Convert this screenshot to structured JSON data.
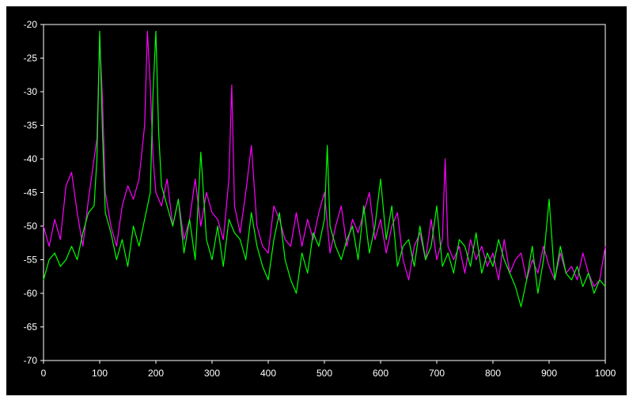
{
  "chart_data": {
    "type": "line",
    "title": "",
    "xlabel": "",
    "ylabel": "",
    "xlim": [
      0,
      1000
    ],
    "ylim": [
      -70,
      -20
    ],
    "x_ticks": [
      0,
      100,
      200,
      300,
      400,
      500,
      600,
      700,
      800,
      900,
      1000
    ],
    "y_ticks": [
      -20,
      -25,
      -30,
      -35,
      -40,
      -45,
      -50,
      -55,
      -60,
      -65,
      -70
    ],
    "x_tick_labels": [
      "0",
      "100",
      "200",
      "300",
      "400",
      "500",
      "600",
      "700",
      "800",
      "900",
      "1000"
    ],
    "y_tick_labels": [
      "-20",
      "-25",
      "-30",
      "-35",
      "-40",
      "-45",
      "-50",
      "-55",
      "-60",
      "-65",
      "-70"
    ],
    "grid": false,
    "legend": "none",
    "background_color": "#000000",
    "plot_area_border_color": "#ffffff",
    "tick_label_color": "#ffffff",
    "series": [
      {
        "color": "#ff00ff",
        "x": [
          0,
          10,
          20,
          30,
          40,
          50,
          60,
          70,
          80,
          90,
          95,
          100,
          105,
          110,
          120,
          130,
          140,
          150,
          160,
          170,
          180,
          185,
          190,
          195,
          200,
          210,
          220,
          230,
          240,
          250,
          260,
          270,
          280,
          290,
          300,
          310,
          320,
          330,
          335,
          340,
          350,
          360,
          370,
          380,
          390,
          400,
          410,
          420,
          430,
          440,
          450,
          460,
          470,
          480,
          490,
          500,
          510,
          520,
          530,
          540,
          550,
          560,
          570,
          580,
          590,
          600,
          610,
          620,
          630,
          640,
          650,
          660,
          670,
          680,
          690,
          700,
          710,
          715,
          720,
          730,
          740,
          750,
          760,
          770,
          780,
          790,
          800,
          810,
          820,
          830,
          840,
          850,
          860,
          870,
          880,
          890,
          900,
          910,
          920,
          930,
          940,
          950,
          960,
          970,
          980,
          990,
          1000
        ],
        "y": [
          -50,
          -53,
          -49,
          -52,
          -44,
          -42,
          -48,
          -53,
          -46,
          -40,
          -37,
          -22,
          -31,
          -45,
          -50,
          -53,
          -47,
          -44,
          -46,
          -43,
          -35,
          -21,
          -29,
          -40,
          -45,
          -47,
          -43,
          -50,
          -46,
          -52,
          -49,
          -43,
          -50,
          -45,
          -48,
          -49,
          -52,
          -43,
          -29,
          -47,
          -51,
          -45,
          -38,
          -50,
          -53,
          -54,
          -47,
          -49,
          -52,
          -53,
          -48,
          -53,
          -49,
          -52,
          -48,
          -45,
          -54,
          -50,
          -47,
          -53,
          -49,
          -51,
          -48,
          -45,
          -52,
          -49,
          -54,
          -50,
          -48,
          -55,
          -58,
          -53,
          -51,
          -55,
          -49,
          -55,
          -52,
          -40,
          -53,
          -55,
          -53,
          -57,
          -52,
          -55,
          -53,
          -56,
          -54,
          -58,
          -52,
          -57,
          -55,
          -54,
          -58,
          -55,
          -57,
          -53,
          -56,
          -58,
          -54,
          -57,
          -56,
          -58,
          -54,
          -57,
          -59,
          -58,
          -53
        ]
      },
      {
        "color": "#00ff00",
        "x": [
          0,
          10,
          20,
          30,
          40,
          50,
          60,
          70,
          80,
          90,
          95,
          100,
          105,
          110,
          120,
          130,
          140,
          150,
          160,
          170,
          180,
          190,
          195,
          200,
          205,
          210,
          220,
          230,
          240,
          250,
          260,
          270,
          280,
          290,
          300,
          310,
          320,
          330,
          340,
          350,
          360,
          370,
          380,
          390,
          400,
          410,
          420,
          430,
          440,
          450,
          460,
          470,
          480,
          490,
          500,
          505,
          510,
          520,
          530,
          540,
          550,
          560,
          570,
          580,
          590,
          600,
          610,
          620,
          630,
          640,
          650,
          660,
          670,
          680,
          690,
          700,
          710,
          720,
          730,
          740,
          750,
          760,
          770,
          780,
          790,
          800,
          810,
          820,
          830,
          840,
          850,
          860,
          870,
          880,
          890,
          900,
          910,
          920,
          930,
          940,
          950,
          960,
          970,
          980,
          990,
          1000
        ],
        "y": [
          -58,
          -55,
          -54,
          -56,
          -55,
          -53,
          -55,
          -51,
          -48,
          -47,
          -40,
          -21,
          -36,
          -48,
          -51,
          -55,
          -52,
          -56,
          -50,
          -53,
          -49,
          -45,
          -30,
          -21,
          -36,
          -44,
          -47,
          -50,
          -46,
          -54,
          -49,
          -55,
          -39,
          -52,
          -55,
          -50,
          -56,
          -49,
          -51,
          -52,
          -55,
          -48,
          -53,
          -56,
          -58,
          -52,
          -48,
          -55,
          -58,
          -60,
          -54,
          -57,
          -51,
          -53,
          -49,
          -38,
          -50,
          -53,
          -55,
          -52,
          -50,
          -55,
          -47,
          -54,
          -50,
          -43,
          -52,
          -47,
          -56,
          -53,
          -52,
          -56,
          -50,
          -55,
          -53,
          -47,
          -56,
          -54,
          -57,
          -52,
          -53,
          -56,
          -51,
          -57,
          -54,
          -56,
          -52,
          -55,
          -57,
          -59,
          -62,
          -58,
          -53,
          -60,
          -55,
          -46,
          -58,
          -53,
          -57,
          -58,
          -56,
          -59,
          -57,
          -60,
          -58,
          -59
        ]
      }
    ]
  }
}
